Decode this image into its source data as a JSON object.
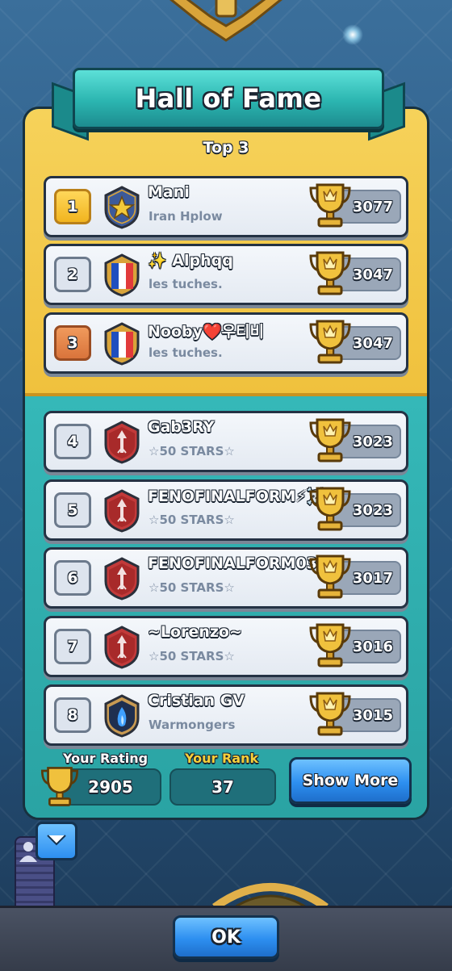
{
  "title": "Hall of Fame",
  "top_label": "Top 3",
  "players": [
    {
      "rank": "1",
      "name": "Mani",
      "clan": "Iran Hplow",
      "trophies": "3077",
      "rank_style": "gold",
      "badge": "star-badge-icon"
    },
    {
      "rank": "2",
      "name": "✨ Alphqq",
      "clan": "les tuches.",
      "trophies": "3047",
      "rank_style": "silver",
      "badge": "french-flag-badge-icon"
    },
    {
      "rank": "3",
      "name": "Nooby❤️우티비",
      "clan": "les tuches.",
      "trophies": "3047",
      "rank_style": "bronze",
      "badge": "french-flag-badge-icon"
    },
    {
      "rank": "4",
      "name": "Gab3RY",
      "clan": "☆50 STARS☆",
      "trophies": "3023",
      "rank_style": "plain",
      "badge": "red-arrow-badge-icon"
    },
    {
      "rank": "5",
      "name": "FENOFINALFORM⚡☠️",
      "clan": "☆50 STARS☆",
      "trophies": "3023",
      "rank_style": "plain",
      "badge": "red-arrow-badge-icon"
    },
    {
      "rank": "6",
      "name": "FENOFINALFORM03",
      "clan": "☆50 STARS☆",
      "trophies": "3017",
      "rank_style": "plain",
      "badge": "red-arrow-badge-icon"
    },
    {
      "rank": "7",
      "name": "~Lorenzo~",
      "clan": "☆50 STARS☆",
      "trophies": "3016",
      "rank_style": "plain",
      "badge": "red-arrow-badge-icon"
    },
    {
      "rank": "8",
      "name": "Cristian GV",
      "clan": "Warmongers",
      "trophies": "3015",
      "rank_style": "plain",
      "badge": "blue-flame-badge-icon"
    }
  ],
  "your_rating": {
    "label": "Your Rating",
    "value": "2905"
  },
  "your_rank": {
    "label": "Your Rank",
    "value": "37"
  },
  "show_more_label": "Show More",
  "ok_label": "OK",
  "colors": {
    "gold_panel": "#f0c13d",
    "teal_panel": "#2aa3a3",
    "your_rank_label": "#f6d03a",
    "button_blue": "#2d8ff0"
  }
}
